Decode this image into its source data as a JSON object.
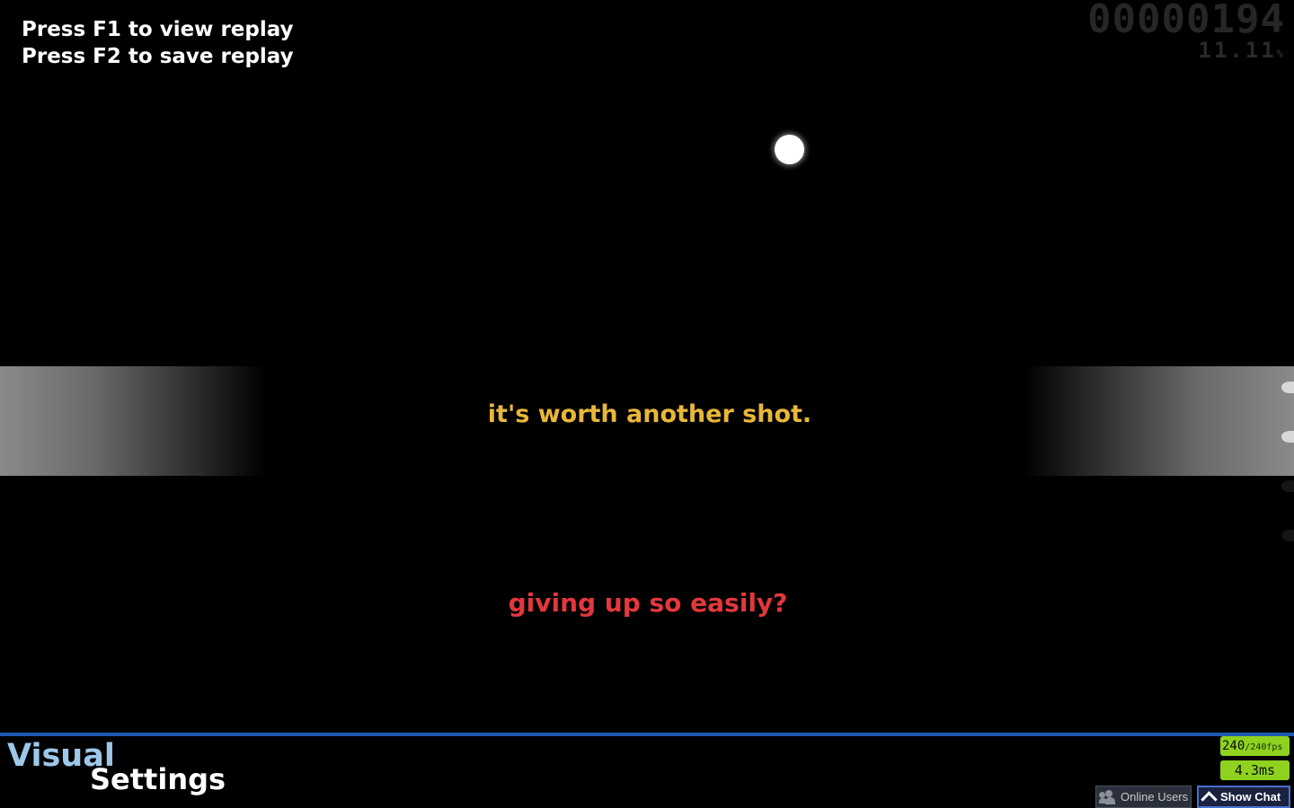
{
  "replay": {
    "line1": "Press F1 to view replay",
    "line2": "Press F2 to save replay"
  },
  "hud": {
    "score": "00000194",
    "accuracy": "11.11",
    "accuracy_unit": "%"
  },
  "messages": {
    "main": "it's worth another shot.",
    "sub": "giving up so easily?"
  },
  "menu_title": {
    "word1": "Visual",
    "word2": "Settings"
  },
  "performance": {
    "fps": "240",
    "fps_cap": "/240fps",
    "frame_time": "4.3ms"
  },
  "buttons": {
    "online_users": "Online Users",
    "show_chat": "Show Chat"
  },
  "icons": {
    "cursor": "cursor-dot",
    "online_users": "users-icon",
    "show_chat": "chevron-up-icon"
  },
  "colors": {
    "main_message": "#e8b739",
    "sub_message": "#e4373c",
    "accent_bar": "#1d5bb0",
    "fps_badge": "#8ed21f"
  }
}
